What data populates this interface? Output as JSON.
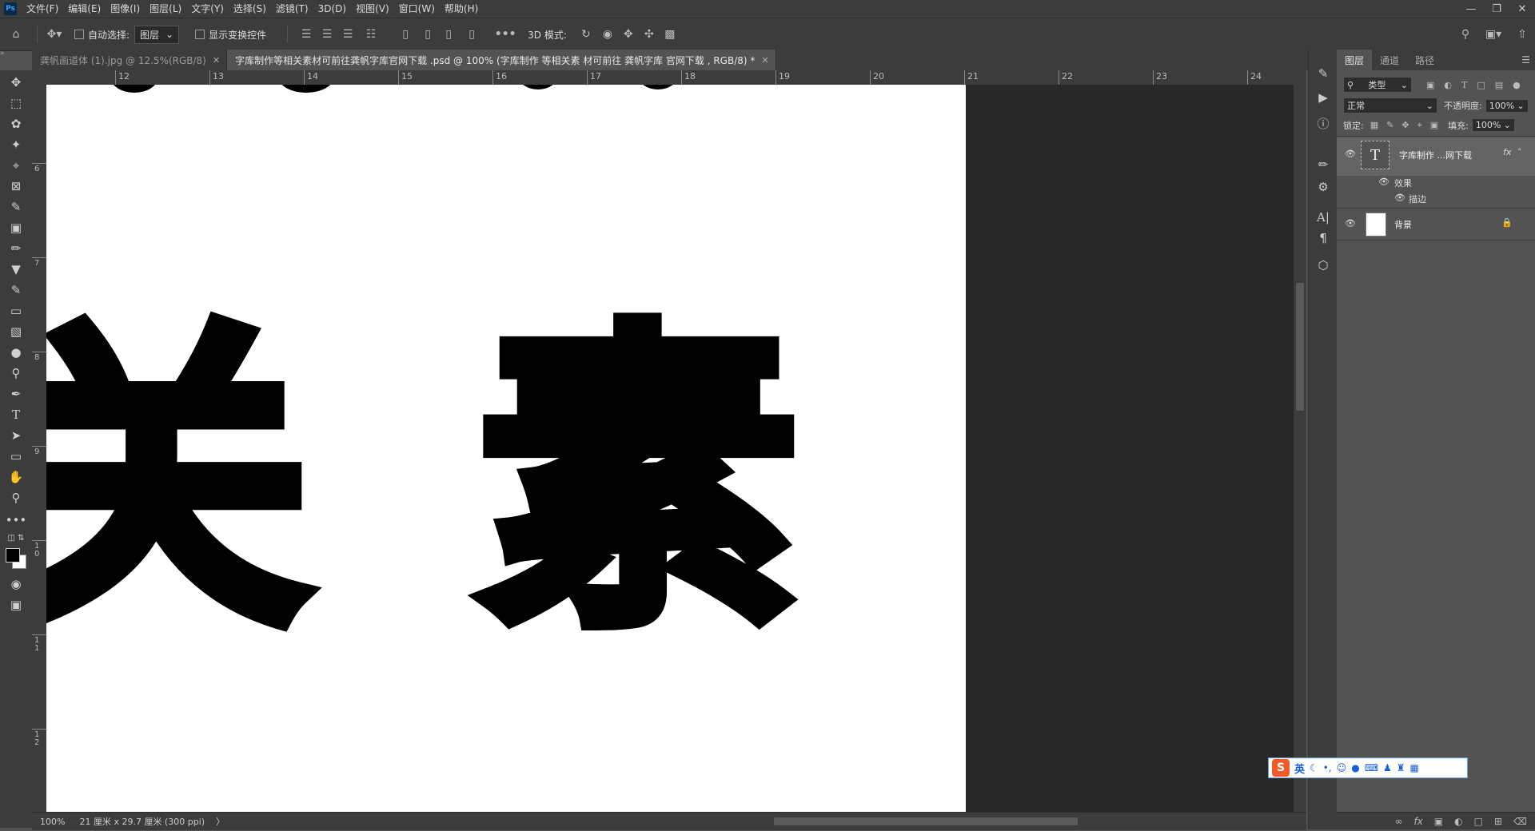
{
  "app": {
    "logo": "Ps"
  },
  "menu": [
    "文件(F)",
    "编辑(E)",
    "图像(I)",
    "图层(L)",
    "文字(Y)",
    "选择(S)",
    "滤镜(T)",
    "3D(D)",
    "视图(V)",
    "窗口(W)",
    "帮助(H)"
  ],
  "options": {
    "auto_select_label": "自动选择:",
    "auto_select_value": "图层",
    "show_transform_label": "显示变换控件",
    "mode3d_label": "3D 模式:"
  },
  "tabs": [
    {
      "label": "龚帆画道体 (1).jpg @ 12.5%(RGB/8)",
      "active": false
    },
    {
      "label": "字库制作等相关素材可前往龚帆字库官网下载 .psd @ 100% (字库制作 等相关素 材可前往 龚帆字库 官网下载 , RGB/8) *",
      "active": true
    }
  ],
  "ruler": {
    "h": [
      "12",
      "13",
      "14",
      "15",
      "16",
      "17",
      "18",
      "19",
      "20",
      "21",
      "22",
      "23",
      "24"
    ],
    "v": [
      "6",
      "7",
      "8",
      "9",
      "1\n0",
      "1\n1",
      "1\n2"
    ]
  },
  "canvas": {
    "glyphs": [
      "关",
      "素"
    ]
  },
  "status": {
    "zoom": "100%",
    "doc_info": "21 厘米 x 29.7 厘米 (300 ppi)",
    "arrow": "〉"
  },
  "layers_panel": {
    "tabs": [
      "图层",
      "通道",
      "路径"
    ],
    "filter_label": "类型",
    "blend_mode": "正常",
    "opacity_label": "不透明度:",
    "opacity_value": "100%",
    "lock_label": "锁定:",
    "fill_label": "填充:",
    "fill_value": "100%",
    "layers": [
      {
        "name": "字库制作 ...网下载",
        "type": "text",
        "fx": "fx",
        "effects_label": "效果",
        "stroke_label": "描边"
      },
      {
        "name": "背景",
        "type": "background",
        "locked": true
      }
    ]
  },
  "ime": {
    "logo": "S",
    "lang": "英"
  }
}
